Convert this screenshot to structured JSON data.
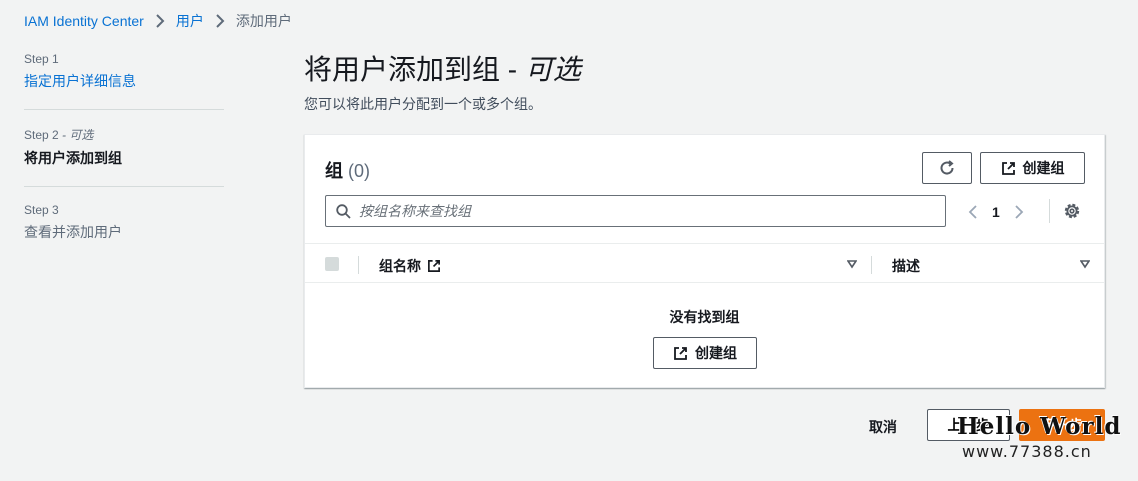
{
  "breadcrumb": {
    "root": "IAM Identity Center",
    "users": "用户",
    "current": "添加用户"
  },
  "steps": [
    {
      "label": "Step 1",
      "title": "指定用户详细信息"
    },
    {
      "label": "Step 2",
      "optional": " - 可选",
      "title": "将用户添加到组"
    },
    {
      "label": "Step 3",
      "title": "查看并添加用户"
    }
  ],
  "page": {
    "title": "将用户添加到组 - ",
    "title_optional": "可选",
    "description": "您可以将此用户分配到一个或多个组。"
  },
  "panel": {
    "title": "组",
    "count": "(0)",
    "create_label": "创建组",
    "search_placeholder": "按组名称来查找组",
    "page_number": "1",
    "columns": {
      "name": "组名称",
      "description": "描述"
    },
    "empty_text": "没有找到组",
    "empty_create_label": "创建组"
  },
  "footer": {
    "cancel": "取消",
    "previous": "上一步",
    "next": "下一步"
  },
  "watermark": {
    "line1": "Hello World",
    "line2": "www.77388.cn"
  },
  "colors": {
    "link": "#0972d3",
    "primary": "#ec7211",
    "background": "#f2f3f3"
  }
}
